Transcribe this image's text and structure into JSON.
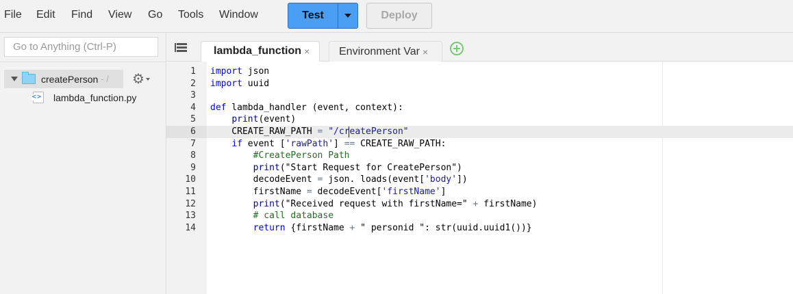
{
  "menu": {
    "items": [
      "File",
      "Edit",
      "Find",
      "View",
      "Go",
      "Tools",
      "Window"
    ],
    "test_label": "Test",
    "deploy_label": "Deploy"
  },
  "sidebar": {
    "goto_placeholder": "Go to Anything (Ctrl-P)",
    "root_folder": "createPerson",
    "root_path": "- /",
    "file_name": "lambda_function.py"
  },
  "tabs": [
    {
      "label": "lambda_function",
      "close": "×"
    },
    {
      "label": "Environment Var",
      "close": "×"
    }
  ],
  "editor": {
    "active_line": 6,
    "lines": [
      {
        "num": "1",
        "tokens": [
          [
            "kw",
            "import"
          ],
          [
            "pn",
            " json"
          ]
        ]
      },
      {
        "num": "2",
        "tokens": [
          [
            "kw",
            "import"
          ],
          [
            "pn",
            " uuid"
          ]
        ]
      },
      {
        "num": "3",
        "tokens": [
          [
            "pn",
            ""
          ]
        ]
      },
      {
        "num": "4",
        "tokens": [
          [
            "kw",
            "def"
          ],
          [
            "pn",
            " lambda_handler (event, context):"
          ]
        ]
      },
      {
        "num": "5",
        "tokens": [
          [
            "pn",
            "    "
          ],
          [
            "fn",
            "print"
          ],
          [
            "pn",
            "(event)"
          ]
        ]
      },
      {
        "num": "6",
        "tokens": [
          [
            "pn",
            "    CREATE_RAW_PATH "
          ],
          [
            "op",
            "="
          ],
          [
            "pn",
            " "
          ],
          [
            "str",
            "\"/createPerson\""
          ]
        ]
      },
      {
        "num": "7",
        "tokens": [
          [
            "pn",
            "    "
          ],
          [
            "kw",
            "if"
          ],
          [
            "pn",
            " event ["
          ],
          [
            "str",
            "'rawPath'"
          ],
          [
            "pn",
            "] "
          ],
          [
            "op",
            "=="
          ],
          [
            "pn",
            " CREATE_RAW_PATH:"
          ]
        ]
      },
      {
        "num": "8",
        "tokens": [
          [
            "pn",
            "        "
          ],
          [
            "cmt",
            "#CreatePerson Path"
          ]
        ]
      },
      {
        "num": "9",
        "tokens": [
          [
            "pn",
            "        "
          ],
          [
            "fn",
            "print"
          ],
          [
            "pn",
            "(\"Start Request for CreatePerson\")"
          ]
        ]
      },
      {
        "num": "10",
        "tokens": [
          [
            "pn",
            "        decodeEvent "
          ],
          [
            "op",
            "="
          ],
          [
            "pn",
            " json. loads(event["
          ],
          [
            "str",
            "'body'"
          ],
          [
            "pn",
            "])"
          ]
        ]
      },
      {
        "num": "11",
        "tokens": [
          [
            "pn",
            "        firstName "
          ],
          [
            "op",
            "="
          ],
          [
            "pn",
            " decodeEvent["
          ],
          [
            "str",
            "'firstName'"
          ],
          [
            "pn",
            "]"
          ]
        ]
      },
      {
        "num": "12",
        "tokens": [
          [
            "pn",
            "        "
          ],
          [
            "fn",
            "print"
          ],
          [
            "pn",
            "(\"Received request with firstName=\" "
          ],
          [
            "op",
            "+"
          ],
          [
            "pn",
            " firstName)"
          ]
        ]
      },
      {
        "num": "13",
        "tokens": [
          [
            "pn",
            "        "
          ],
          [
            "cmt",
            "# call database"
          ]
        ]
      },
      {
        "num": "14",
        "tokens": [
          [
            "pn",
            "        "
          ],
          [
            "kw",
            "return"
          ],
          [
            "pn",
            " {firstName "
          ],
          [
            "op",
            "+"
          ],
          [
            "pn",
            " \" personid \": str(uuid.uuid1())}"
          ]
        ]
      }
    ]
  }
}
